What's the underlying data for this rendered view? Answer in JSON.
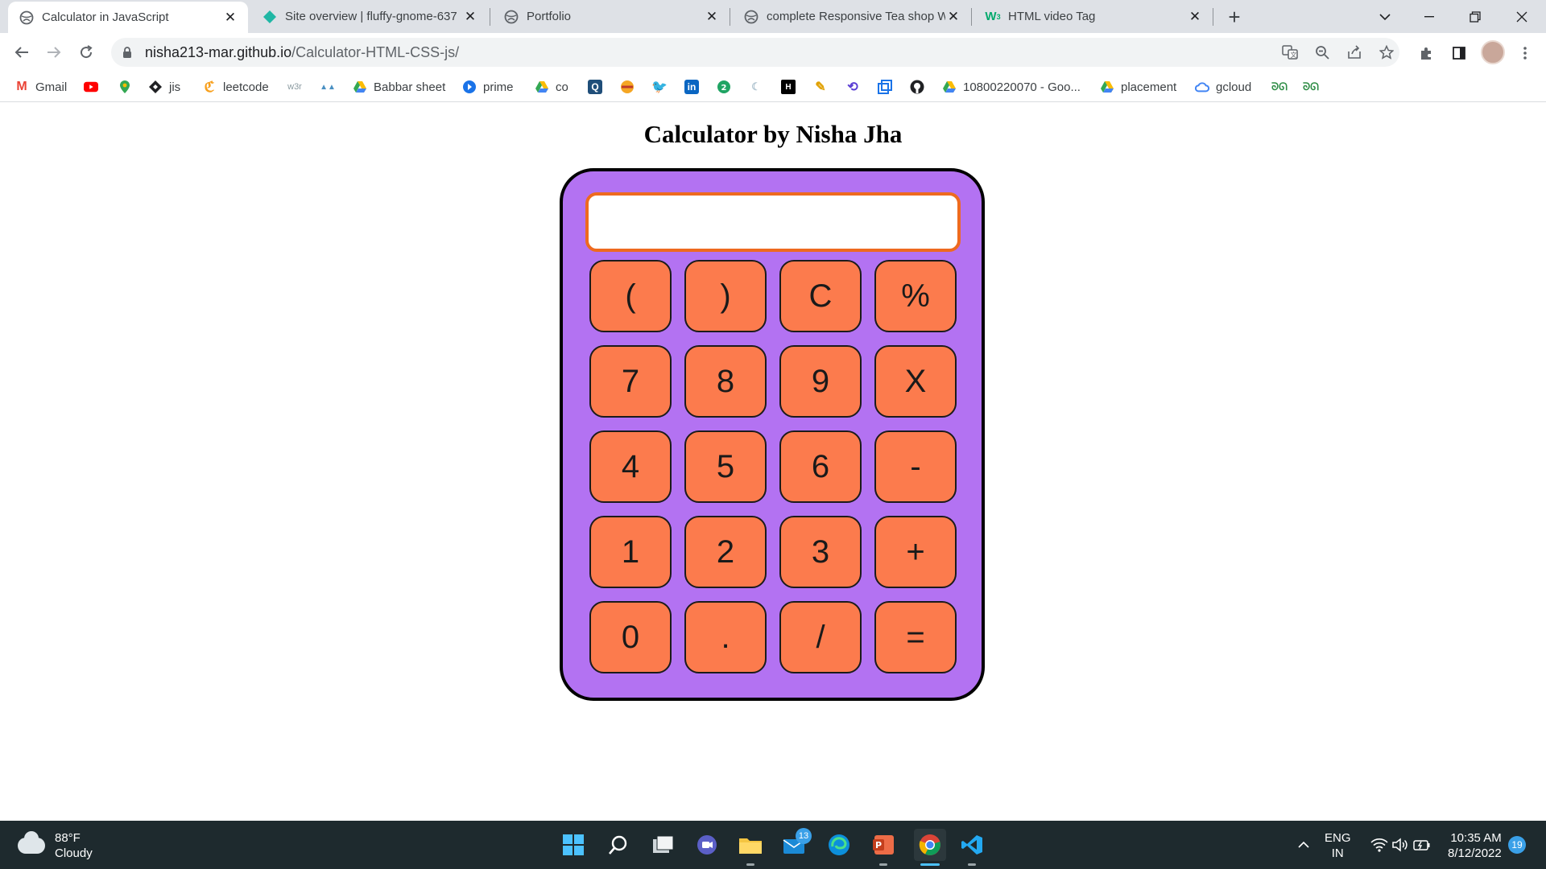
{
  "browser": {
    "tabs": [
      {
        "title": "Calculator in JavaScript",
        "favicon": "globe-icon",
        "active": true
      },
      {
        "title": "Site overview | fluffy-gnome-637",
        "favicon": "netlify-icon",
        "active": false
      },
      {
        "title": "Portfolio",
        "favicon": "globe-icon",
        "active": false
      },
      {
        "title": "complete Responsive Tea shop W",
        "favicon": "globe-icon",
        "active": false
      },
      {
        "title": "HTML video Tag",
        "favicon": "w3-icon",
        "active": false
      }
    ],
    "url_host": "nisha213-mar.github.io",
    "url_path": "/Calculator-HTML-CSS-js/",
    "bookmarks": [
      {
        "label": "Gmail",
        "icon": "gmail-icon"
      },
      {
        "label": "",
        "icon": "youtube-icon"
      },
      {
        "label": "",
        "icon": "maps-icon"
      },
      {
        "label": "jis",
        "icon": "jira-icon"
      },
      {
        "label": "leetcode",
        "icon": "leetcode-icon"
      },
      {
        "label": "",
        "icon": "w3schools-icon"
      },
      {
        "label": "",
        "icon": "sheet-icon"
      },
      {
        "label": "Babbar sheet",
        "icon": "drive-icon"
      },
      {
        "label": "prime",
        "icon": "prime-icon"
      },
      {
        "label": "co",
        "icon": "drive-icon"
      },
      {
        "label": "",
        "icon": "search-tool-icon"
      },
      {
        "label": "",
        "icon": "codechef-icon"
      },
      {
        "label": "",
        "icon": "twitter-icon"
      },
      {
        "label": "",
        "icon": "linkedin-icon"
      },
      {
        "label": "",
        "icon": "chat-icon"
      },
      {
        "label": "",
        "icon": "moon-icon"
      },
      {
        "label": "",
        "icon": "hackerrank-icon"
      },
      {
        "label": "",
        "icon": "pen-icon"
      },
      {
        "label": "",
        "icon": "sync-icon"
      },
      {
        "label": "",
        "icon": "window-icon"
      },
      {
        "label": "",
        "icon": "github-icon"
      },
      {
        "label": "10800220070 - Goo...",
        "icon": "drive-icon"
      },
      {
        "label": "placement",
        "icon": "drive-icon"
      },
      {
        "label": "gcloud",
        "icon": "cloud-icon"
      },
      {
        "label": "",
        "icon": "gfg-icon"
      },
      {
        "label": "",
        "icon": "gfg-icon"
      }
    ]
  },
  "page": {
    "title": "Calculator by Nisha Jha",
    "display_value": "",
    "keys": [
      [
        "(",
        ")",
        "C",
        "%"
      ],
      [
        "7",
        "8",
        "9",
        "X"
      ],
      [
        "4",
        "5",
        "6",
        "-"
      ],
      [
        "1",
        "2",
        "3",
        "+"
      ],
      [
        "0",
        ".",
        "/",
        "="
      ]
    ]
  },
  "colors": {
    "calculator_body": "#b372f2",
    "key_fill": "#fc7b4d",
    "display_border": "#ee6a1f"
  },
  "taskbar": {
    "weather_temp": "88°F",
    "weather_desc": "Cloudy",
    "language": "ENG",
    "region": "IN",
    "time": "10:35 AM",
    "date": "8/12/2022",
    "notification_count": "19",
    "mail_badge": "13"
  }
}
